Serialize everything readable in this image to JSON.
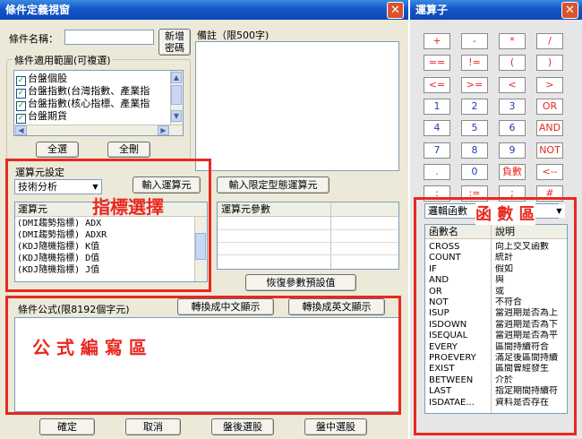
{
  "left": {
    "title": "條件定義視窗",
    "cond_name_label": "條件名稱：",
    "new_btn": [
      "新增",
      "密碼"
    ],
    "note_label": "備註（限500字)",
    "scope_label": "條件適用範圍(可複選)",
    "scope_items": [
      "台盤個股",
      "台盤指數(台灣指數、產業指",
      "台盤指數(核心指標、產業指",
      "台盤期貨"
    ],
    "select_all": "全選",
    "clear_all": "全刪",
    "operand_group_label": "運算元設定",
    "operand_category": "技術分析",
    "input_operand_btn": "輸入運算元",
    "input_limited_btn": "輸入限定型態運算元",
    "operand_list_header": "運算元",
    "operand_items": [
      "(DMI趨勢指標) ADX",
      "(DMI趨勢指標) ADXR",
      "(KDJ隨機指標) K值",
      "(KDJ隨機指標) D值",
      "(KDJ隨機指標) J值"
    ],
    "param_header": "運算元參數",
    "restore_btn": "恢復參數預設值",
    "formula_label": "條件公式(限8192個字元)",
    "to_chinese_btn": "轉換成中文顯示",
    "to_english_btn": "轉換成英文顯示",
    "ok_btn": "確定",
    "cancel_btn": "取消",
    "after_btn": "盤後選股",
    "during_btn": "盤中選股",
    "annotation_indicator": "指標選擇",
    "annotation_formula": "公 式 編 寫 區"
  },
  "right": {
    "title": "運算子",
    "operators": [
      "+",
      "-",
      "*",
      "/",
      "==",
      "!=",
      "(",
      ")",
      "<=",
      ">=",
      "<",
      ">",
      "1",
      "2",
      "3",
      "OR",
      "4",
      "5",
      "6",
      "AND",
      "7",
      "8",
      "9",
      "NOT",
      ".",
      "0",
      "負數",
      "<--",
      ":",
      ":=",
      ";",
      "#"
    ],
    "func_category": "邏輯函數",
    "annotation_func": "函 數 區",
    "func_headers": [
      "函數名",
      "說明"
    ],
    "functions": [
      [
        "CROSS",
        "向上交叉函數"
      ],
      [
        "COUNT",
        "統計"
      ],
      [
        "IF",
        "假如"
      ],
      [
        "AND",
        "與"
      ],
      [
        "OR",
        "或"
      ],
      [
        "NOT",
        "不符合"
      ],
      [
        "ISUP",
        "當週期是否為上"
      ],
      [
        "ISDOWN",
        "當週期是否為下"
      ],
      [
        "ISEQUAL",
        "當週期是否為平"
      ],
      [
        "EVERY",
        "區間持續符合"
      ],
      [
        "PROEVERY",
        "滿足後區間持續"
      ],
      [
        "EXIST",
        "區間曾經發生"
      ],
      [
        "BETWEEN",
        "介於"
      ],
      [
        "LAST",
        "指定期間持續符"
      ],
      [
        "ISDATAE...",
        "資料是否存在"
      ]
    ]
  },
  "colors": {
    "titlebar": "#1456c8",
    "annotation": "#e8281f",
    "operator_text": "#e8281f",
    "window_bg": "#ece9d8"
  }
}
